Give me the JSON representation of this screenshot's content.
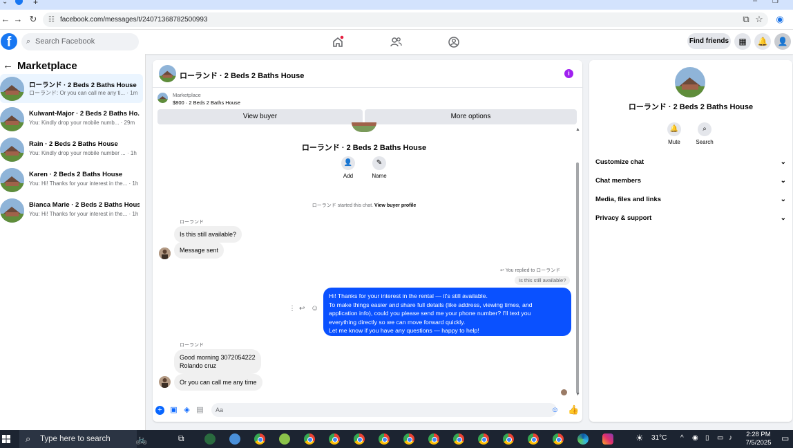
{
  "browser": {
    "url": "facebook.com/messages/t/24071368782500993"
  },
  "fb": {
    "logo": "f",
    "search_placeholder": "Search Facebook",
    "find_friends": "Find friends"
  },
  "sidebar": {
    "title": "Marketplace",
    "conversations": [
      {
        "name": "ローランド · 2 Beds 2 Baths House",
        "snippet": "ローランド: Or you can call me any ti... · 1m"
      },
      {
        "name": "Kulwant-Major · 2 Beds 2 Baths Ho...",
        "snippet": "You: Kindly drop your mobile numb... · 29m"
      },
      {
        "name": "Rain · 2 Beds 2 Baths House",
        "snippet": "You: Kindly drop your mobile number ... · 1h"
      },
      {
        "name": "Karen · 2 Beds 2 Baths House",
        "snippet": "You: Hi! Thanks for your interest in the... · 1h"
      },
      {
        "name": "Bianca Marie · 2 Beds 2 Baths House",
        "snippet": "You: Hi! Thanks for your interest in the... · 1h"
      }
    ]
  },
  "chat": {
    "title": "ローランド · 2 Beds 2 Baths House",
    "listing_source": "Marketplace",
    "listing_detail": "$800 · 2 Beds 2 Baths House",
    "view_buyer": "View buyer",
    "more_options": "More options",
    "profile_name": "ローランド · 2 Beds 2 Baths House",
    "add_label": "Add",
    "name_label": "Name",
    "started_text": "ローランド started this chat.",
    "view_buyer_profile": "View buyer profile",
    "sender_name": "ローランド",
    "msg1": "Is this still available?",
    "msg2": "Message sent",
    "replied_to": "You replied to ローランド",
    "quoted": "Is this still available?",
    "reply_lines": [
      "Hi! Thanks for your interest in the rental — it's still available.",
      "To make things easier and share full details (like address, viewing times, and",
      "application info), could you please send me your phone number? I'll text you",
      "everything directly so we can move forward quickly.",
      "Let me know if you have any questions — happy to help!"
    ],
    "sender_name2": "ローランド",
    "msg3_line1": "Good morning 3072054222",
    "msg3_line2": "Rolando cruz",
    "msg4": "Or you can call me any time",
    "composer_placeholder": "Aa"
  },
  "info": {
    "name": "ローランド · 2 Beds 2 Baths House",
    "mute": "Mute",
    "search": "Search",
    "sections": [
      "Customize chat",
      "Chat members",
      "Media, files and links",
      "Privacy & support"
    ]
  },
  "taskbar": {
    "search_placeholder": "Type here to search",
    "temperature": "31°C",
    "time": "2:28 PM",
    "date": "7/5/2025"
  },
  "colors": {
    "accent": "#0866ff",
    "outgoing_bubble": "#0a51ff",
    "info_button": "#a020f0"
  }
}
